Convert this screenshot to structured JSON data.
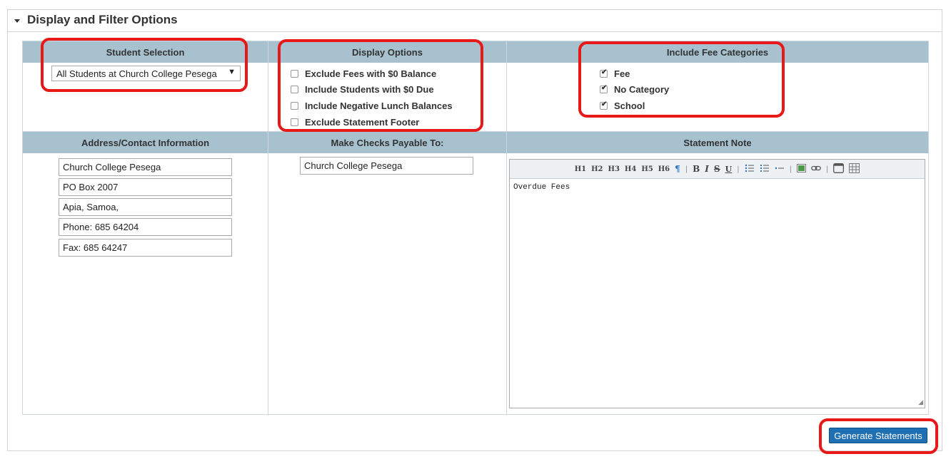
{
  "panel": {
    "title": "Display and Filter Options"
  },
  "student_selection": {
    "header": "Student Selection",
    "selected": "All Students at Church College Pesega"
  },
  "display_options": {
    "header": "Display Options",
    "items": [
      {
        "label": "Exclude Fees with $0 Balance",
        "checked": false
      },
      {
        "label": "Include Students with $0 Due",
        "checked": false
      },
      {
        "label": "Include Negative Lunch Balances",
        "checked": false
      },
      {
        "label": "Exclude Statement Footer",
        "checked": false
      }
    ]
  },
  "fee_categories": {
    "header": "Include Fee Categories",
    "items": [
      {
        "label": "Fee",
        "checked": true
      },
      {
        "label": "No Category",
        "checked": true
      },
      {
        "label": "School",
        "checked": true
      }
    ]
  },
  "address": {
    "header": "Address/Contact Information",
    "lines": [
      "Church College Pesega",
      "PO Box 2007",
      "Apia, Samoa,",
      "Phone: 685 64204",
      "Fax: 685 64247"
    ]
  },
  "checks_payable": {
    "header": "Make Checks Payable To:",
    "value": "Church College Pesega"
  },
  "statement_note": {
    "header": "Statement Note",
    "text": "Overdue Fees",
    "toolbar": {
      "h1": "H1",
      "h2": "H2",
      "h3": "H3",
      "h4": "H4",
      "h5": "H5",
      "h6": "H6",
      "paragraph": "¶",
      "bold": "B",
      "italic": "I",
      "strike": "S",
      "underline": "U"
    }
  },
  "generate_button": "Generate Statements"
}
